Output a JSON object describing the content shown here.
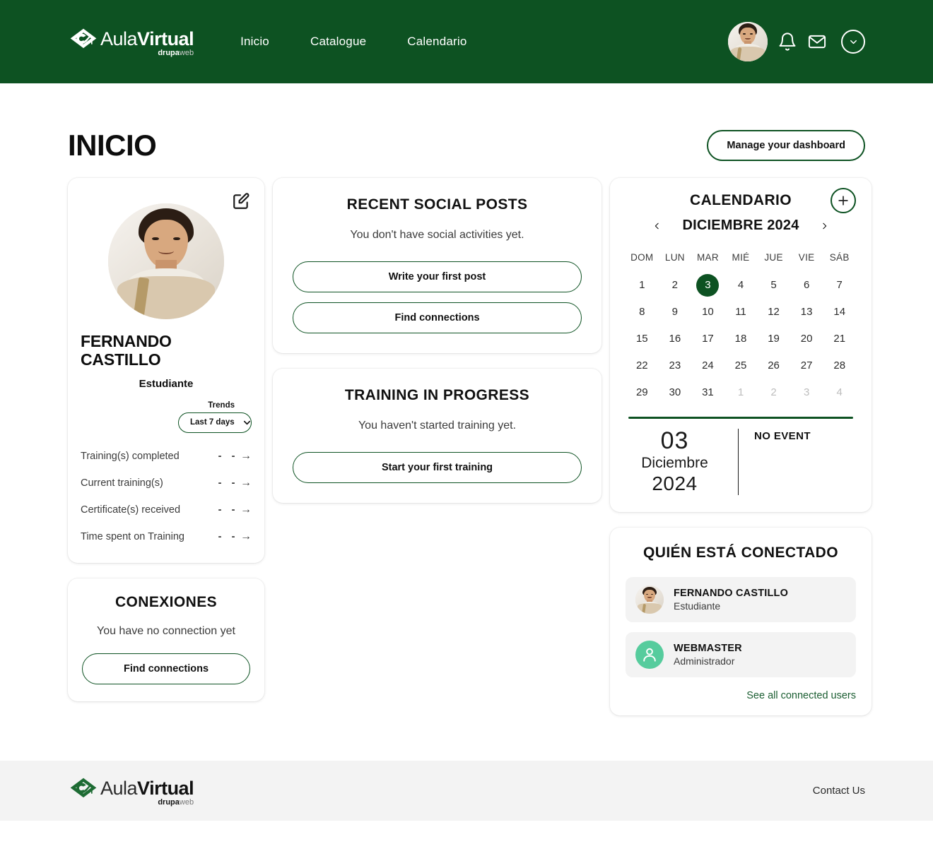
{
  "brand": {
    "name_light": "Aula",
    "name_bold": "Virtual",
    "sub_bold": "drupa",
    "sub_light": "web",
    "logo_icon": "graduation-cap-check-icon",
    "header_bg": "#0d5222",
    "accent_green": "#0d5222",
    "link_green": "#1b5e32",
    "generic_avatar_bg": "#56cc9d"
  },
  "header": {
    "nav": [
      {
        "label": "Inicio"
      },
      {
        "label": "Catalogue"
      },
      {
        "label": "Calendario"
      }
    ],
    "icons": {
      "avatar": "user-avatar-photo",
      "notifications": "bell-icon",
      "messages": "envelope-icon",
      "account_menu": "chevron-down-icon"
    }
  },
  "page": {
    "title": "INICIO",
    "manage_button": "Manage your dashboard"
  },
  "profile": {
    "edit_icon": "edit-pencil-square-icon",
    "avatar": "user-avatar-photo",
    "name": "FERNANDO CASTILLO",
    "name_line1": "FERNANDO",
    "name_line2": "CASTILLO",
    "role": "Estudiante",
    "trends_label": "Trends",
    "trends_selected": "Last 7 days",
    "trends_options": [
      "Last 7 days"
    ],
    "stats": [
      {
        "label": "Training(s) completed",
        "value": "-",
        "delta": "-",
        "trend": "→"
      },
      {
        "label": "Current training(s)",
        "value": "-",
        "delta": "-",
        "trend": "→"
      },
      {
        "label": "Certificate(s) received",
        "value": "-",
        "delta": "-",
        "trend": "→"
      },
      {
        "label": "Time spent on Training",
        "value": "-",
        "delta": "-",
        "trend": "→"
      }
    ]
  },
  "connections": {
    "title": "CONEXIONES",
    "empty": "You have no connection yet",
    "button": "Find connections"
  },
  "social": {
    "title": "RECENT SOCIAL POSTS",
    "empty": "You don't have social activities yet.",
    "button_primary": "Write your first post",
    "button_secondary": "Find connections"
  },
  "training": {
    "title": "TRAINING IN PROGRESS",
    "empty": "You haven't started training yet.",
    "button": "Start your first training"
  },
  "calendar": {
    "title": "CALENDARIO",
    "add_icon": "plus-circle-icon",
    "prev_icon": "chevron-left-icon",
    "next_icon": "chevron-right-icon",
    "month_year": "DICIEMBRE 2024",
    "weekdays": [
      "DOM",
      "LUN",
      "MAR",
      "MIÉ",
      "JUE",
      "VIE",
      "SÁB"
    ],
    "days": [
      {
        "n": "1",
        "state": "normal"
      },
      {
        "n": "2",
        "state": "normal"
      },
      {
        "n": "3",
        "state": "today"
      },
      {
        "n": "4",
        "state": "normal"
      },
      {
        "n": "5",
        "state": "normal"
      },
      {
        "n": "6",
        "state": "normal"
      },
      {
        "n": "7",
        "state": "normal"
      },
      {
        "n": "8",
        "state": "normal"
      },
      {
        "n": "9",
        "state": "normal"
      },
      {
        "n": "10",
        "state": "normal"
      },
      {
        "n": "11",
        "state": "normal"
      },
      {
        "n": "12",
        "state": "normal"
      },
      {
        "n": "13",
        "state": "normal"
      },
      {
        "n": "14",
        "state": "normal"
      },
      {
        "n": "15",
        "state": "normal"
      },
      {
        "n": "16",
        "state": "normal"
      },
      {
        "n": "17",
        "state": "normal"
      },
      {
        "n": "18",
        "state": "normal"
      },
      {
        "n": "19",
        "state": "normal"
      },
      {
        "n": "20",
        "state": "normal"
      },
      {
        "n": "21",
        "state": "normal"
      },
      {
        "n": "22",
        "state": "normal"
      },
      {
        "n": "23",
        "state": "normal"
      },
      {
        "n": "24",
        "state": "normal"
      },
      {
        "n": "25",
        "state": "normal"
      },
      {
        "n": "26",
        "state": "normal"
      },
      {
        "n": "27",
        "state": "normal"
      },
      {
        "n": "28",
        "state": "normal"
      },
      {
        "n": "29",
        "state": "normal"
      },
      {
        "n": "30",
        "state": "normal"
      },
      {
        "n": "31",
        "state": "normal"
      },
      {
        "n": "1",
        "state": "muted"
      },
      {
        "n": "2",
        "state": "muted"
      },
      {
        "n": "3",
        "state": "muted"
      },
      {
        "n": "4",
        "state": "muted"
      }
    ],
    "selected_day": "03",
    "selected_month": "Diciembre",
    "selected_year": "2024",
    "event_title": "NO EVENT"
  },
  "who_connected": {
    "title": "QUIÉN ESTÁ CONECTADO",
    "users": [
      {
        "name": "FERNANDO CASTILLO",
        "role": "Estudiante",
        "avatar": "user-avatar-photo"
      },
      {
        "name": "WEBMASTER",
        "role": "Administrador",
        "avatar": "generic-person-icon"
      }
    ],
    "see_all": "See all connected users"
  },
  "footer": {
    "contact": "Contact Us"
  }
}
